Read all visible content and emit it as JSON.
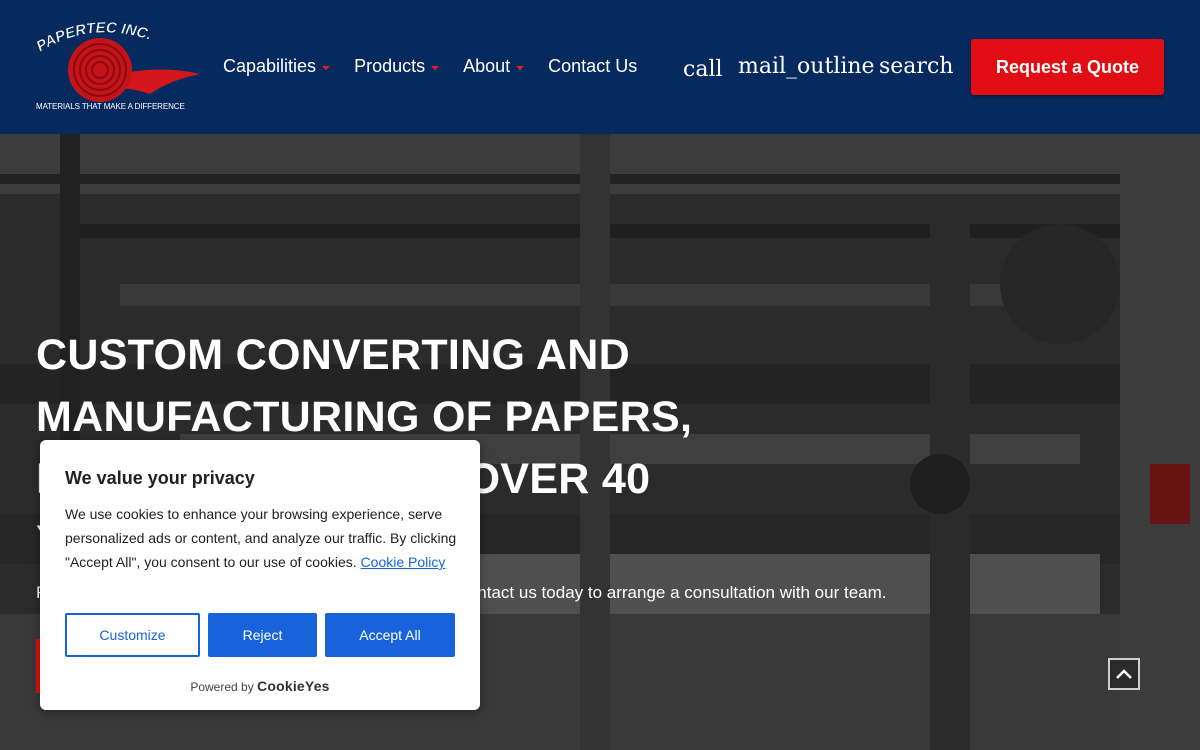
{
  "header": {
    "logo": {
      "name": "PAPERTEC INC.",
      "tagline": "MATERIALS THAT MAKE A DIFFERENCE"
    },
    "nav": [
      {
        "label": "Capabilities",
        "has_dropdown": true
      },
      {
        "label": "Products",
        "has_dropdown": true
      },
      {
        "label": "About",
        "has_dropdown": true
      },
      {
        "label": "Contact Us",
        "has_dropdown": false
      }
    ],
    "icons": {
      "call": "call",
      "mail": "mail_outline",
      "search": "search"
    },
    "quote_button": "Request a Quote"
  },
  "hero": {
    "title_lines": [
      "CUSTOM CONVERTING AND",
      "MANUFACTURING OF PAPERS,",
      "FILMS & FOILS FOR OVER 40",
      "YEARS"
    ],
    "subtitle": "Facing a materials challenge? Papertec is here to help! Contact us today to arrange a consultation with our team."
  },
  "cookie_banner": {
    "title": "We value your privacy",
    "body": "We use cookies to enhance your browsing experience, serve personalized ads or content, and analyze our traffic. By clicking \"Accept All\", you consent to our use of cookies.",
    "policy_link": "Cookie Policy",
    "buttons": {
      "customize": "Customize",
      "reject": "Reject",
      "accept": "Accept All"
    },
    "powered_by": "Powered by",
    "brand": "CookieYes"
  },
  "colors": {
    "header_bg": "#062a5e",
    "accent_red": "#e00d12",
    "cookie_blue": "#1863dc"
  }
}
